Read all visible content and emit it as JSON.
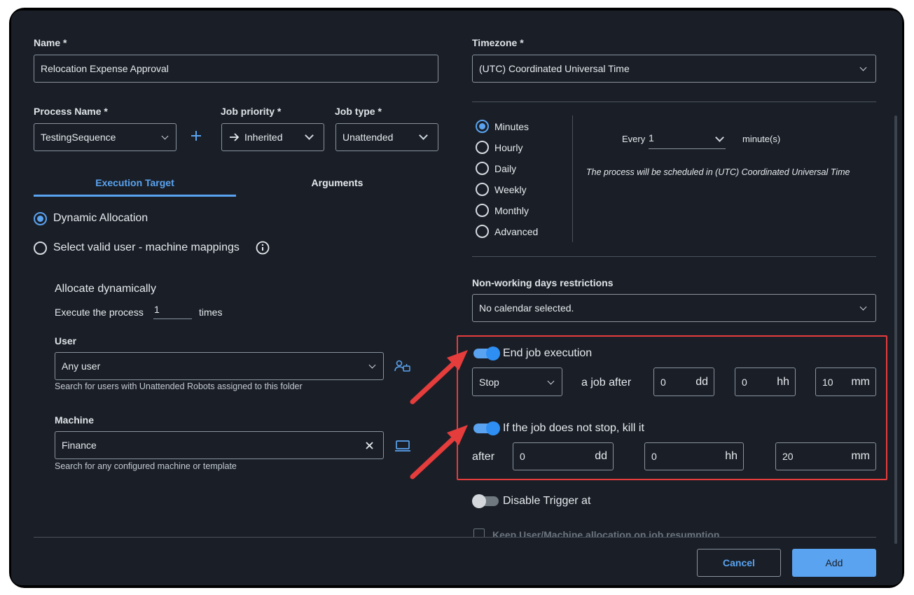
{
  "form": {
    "name_label": "Name *",
    "name_value": "Relocation Expense Approval",
    "process_label": "Process Name *",
    "process_value": "TestingSequence",
    "priority_label": "Job priority *",
    "priority_value": "Inherited",
    "jobtype_label": "Job type *",
    "jobtype_value": "Unattended",
    "tabs": [
      {
        "label": "Execution Target"
      },
      {
        "label": "Arguments"
      }
    ],
    "radio_dynamic": "Dynamic Allocation",
    "radio_mappings": "Select valid user - machine mappings",
    "allocate_title": "Allocate dynamically",
    "execute_prefix": "Execute the process",
    "execute_count": "1",
    "execute_suffix": "times",
    "user_label": "User",
    "user_value": "Any user",
    "user_hint": "Search for users with Unattended Robots assigned to this folder",
    "machine_label": "Machine",
    "machine_value": "Finance",
    "machine_hint": "Search for any configured machine or template"
  },
  "schedule": {
    "timezone_label": "Timezone *",
    "timezone_value": "(UTC) Coordinated Universal Time",
    "frequencies": [
      "Minutes",
      "Hourly",
      "Daily",
      "Weekly",
      "Monthly",
      "Advanced"
    ],
    "selected_frequency": "Minutes",
    "every_label": "Every",
    "every_value": "1",
    "every_unit": "minute(s)",
    "schedule_note": "The process will be scheduled in (UTC) Coordinated Universal Time",
    "nonworking_label": "Non-working days restrictions",
    "nonworking_value": "No calendar selected."
  },
  "end_job": {
    "toggle_label": "End job execution",
    "enabled": true,
    "action_value": "Stop",
    "after_text": "a job after",
    "dd": "0",
    "dd_unit": "dd",
    "hh": "0",
    "hh_unit": "hh",
    "mm": "10",
    "mm_unit": "mm"
  },
  "kill_job": {
    "toggle_label": "If the job does not stop, kill it",
    "enabled": true,
    "after_text": "after",
    "dd": "0",
    "dd_unit": "dd",
    "hh": "0",
    "hh_unit": "hh",
    "mm": "20",
    "mm_unit": "mm"
  },
  "disable_trigger": {
    "label": "Disable Trigger at",
    "enabled": false
  },
  "keep_allocation": {
    "label": "Keep User/Machine allocation on job resumption"
  },
  "footer": {
    "cancel_label": "Cancel",
    "add_label": "Add"
  },
  "colors": {
    "accent": "#5aa3f0",
    "highlight": "#e53c3c",
    "background": "#1a1f27"
  }
}
